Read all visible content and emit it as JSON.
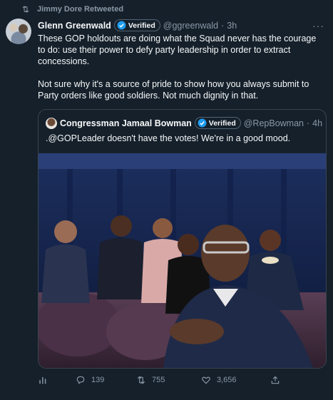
{
  "retweet": {
    "label": "Jimmy Dore Retweeted",
    "icon": "retweet-icon"
  },
  "tweet": {
    "author_name": "Glenn Greenwald",
    "verified_label": "Verified",
    "handle": "@ggreenwald",
    "separator": "·",
    "time": "3h",
    "more": "···",
    "paragraph_1": "These GOP holdouts are doing what the Squad never has the courage to do: use their power to defy party leadership in order to extract concessions.",
    "paragraph_2": "Not sure why it's a source of pride to show how you always submit to Party orders like good soldiers. Not much dignity in that."
  },
  "quote": {
    "author_name": "Congressman Jamaal Bowman",
    "verified_label": "Verified",
    "handle": "@RepBowman",
    "separator": "·",
    "time": "4h",
    "text": ".@GOPLeader doesn't have the votes! We're in a good mood."
  },
  "actions": {
    "analytics_icon": "analytics-icon",
    "reply_count": "139",
    "retweet_count": "755",
    "like_count": "3,656",
    "share_icon": "share-icon"
  },
  "colors": {
    "background": "#15202b",
    "text": "#f7f9f9",
    "muted": "#8b98a5",
    "border": "#38444d",
    "verified": "#1d9bf0"
  }
}
